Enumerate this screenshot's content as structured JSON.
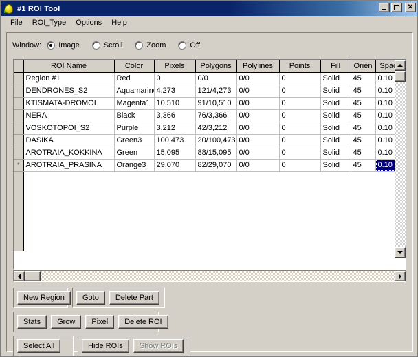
{
  "window": {
    "title": "#1 ROI Tool",
    "icon": "egg-icon",
    "minimize_label": "Minimize",
    "maximize_label": "Maximize",
    "close_label": "Close",
    "titlebar_color": "#0a246a"
  },
  "menu": {
    "items": [
      {
        "label": "File"
      },
      {
        "label": "ROI_Type"
      },
      {
        "label": "Options"
      },
      {
        "label": "Help"
      }
    ]
  },
  "window_mode": {
    "label": "Window:",
    "options": [
      {
        "label": "Image",
        "selected": true
      },
      {
        "label": "Scroll",
        "selected": false
      },
      {
        "label": "Zoom",
        "selected": false
      },
      {
        "label": "Off",
        "selected": false
      }
    ]
  },
  "table": {
    "columns": [
      "ROI Name",
      "Color",
      "Pixels",
      "Polygons",
      "Polylines",
      "Points",
      "Fill",
      "Orien",
      "Space"
    ],
    "rows": [
      {
        "marker": "",
        "name": "Region #1",
        "color": "Red",
        "pixels": "0",
        "polygons": "0/0",
        "polylines": "0/0",
        "points": "0",
        "fill": "Solid",
        "orien": "45",
        "space": "0.10",
        "selected_col": null
      },
      {
        "marker": "",
        "name": "DENDRONES_S2",
        "color": "Aquamarine",
        "pixels": "4,273",
        "polygons": "121/4,273",
        "polylines": "0/0",
        "points": "0",
        "fill": "Solid",
        "orien": "45",
        "space": "0.10",
        "selected_col": null
      },
      {
        "marker": "",
        "name": "KTISMATA-DROMOI",
        "color": "Magenta1",
        "pixels": "10,510",
        "polygons": "91/10,510",
        "polylines": "0/0",
        "points": "0",
        "fill": "Solid",
        "orien": "45",
        "space": "0.10",
        "selected_col": null
      },
      {
        "marker": "",
        "name": "NERA",
        "color": "Black",
        "pixels": "3,366",
        "polygons": "76/3,366",
        "polylines": "0/0",
        "points": "0",
        "fill": "Solid",
        "orien": "45",
        "space": "0.10",
        "selected_col": null
      },
      {
        "marker": "",
        "name": "VOSKOTOPOI_S2",
        "color": "Purple",
        "pixels": "3,212",
        "polygons": "42/3,212",
        "polylines": "0/0",
        "points": "0",
        "fill": "Solid",
        "orien": "45",
        "space": "0.10",
        "selected_col": null
      },
      {
        "marker": "",
        "name": "DASIKA",
        "color": "Green3",
        "pixels": "100,473",
        "polygons": "20/100,473",
        "polylines": "0/0",
        "points": "0",
        "fill": "Solid",
        "orien": "45",
        "space": "0.10",
        "selected_col": null
      },
      {
        "marker": "",
        "name": "AROTRAIA_KOKKINA",
        "color": "Green",
        "pixels": "15,095",
        "polygons": "88/15,095",
        "polylines": "0/0",
        "points": "0",
        "fill": "Solid",
        "orien": "45",
        "space": "0.10",
        "selected_col": null
      },
      {
        "marker": "*",
        "name": "AROTRAIA_PRASINA",
        "color": "Orange3",
        "pixels": "29,070",
        "polygons": "82/29,070",
        "polylines": "0/0",
        "points": "0",
        "fill": "Solid",
        "orien": "45",
        "space": "0.10",
        "selected_col": "space"
      }
    ],
    "selection_color": "#000080"
  },
  "scrollbars": {
    "vertical": {
      "up_icon": "scroll-up-icon",
      "down_icon": "scroll-down-icon"
    },
    "horizontal": {
      "left_icon": "scroll-left-icon",
      "right_icon": "scroll-right-icon"
    }
  },
  "buttons": {
    "group1": [
      {
        "label": "New Region",
        "disabled": false
      },
      {
        "label": "Goto",
        "disabled": false
      },
      {
        "label": "Delete Part",
        "disabled": false
      }
    ],
    "group2": [
      {
        "label": "Stats",
        "disabled": false
      },
      {
        "label": "Grow",
        "disabled": false
      },
      {
        "label": "Pixel",
        "disabled": false
      },
      {
        "label": "Delete ROI",
        "disabled": false
      }
    ],
    "group3": [
      {
        "label": "Select All",
        "disabled": false
      },
      {
        "label": "Hide ROIs",
        "disabled": false
      },
      {
        "label": "Show ROIs",
        "disabled": true
      }
    ]
  }
}
